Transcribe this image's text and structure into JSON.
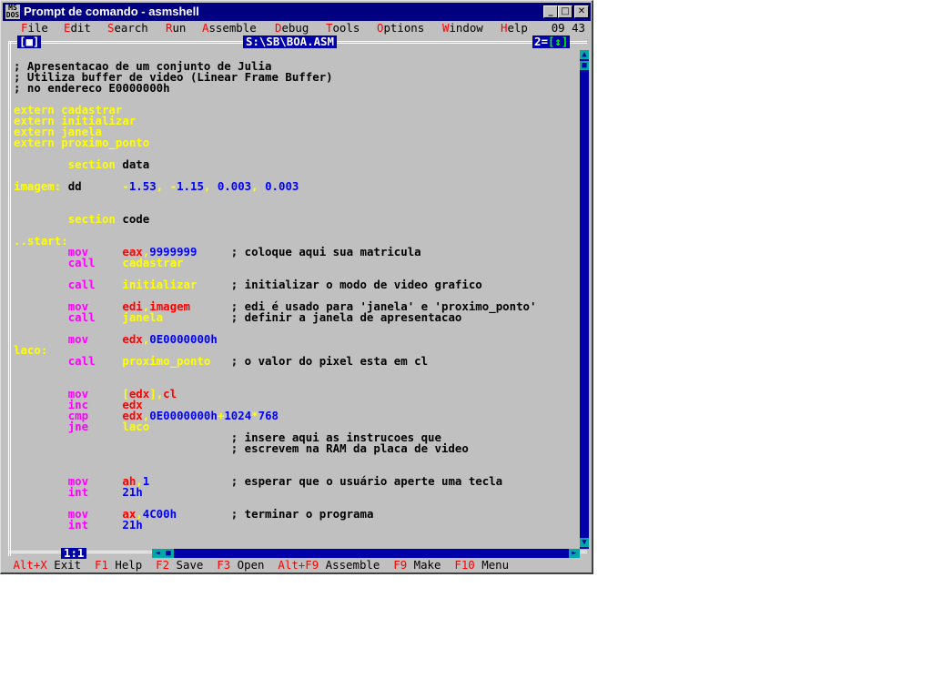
{
  "window": {
    "title": "Prompt de comando - asmshell",
    "icon_text": [
      "MS",
      "DOS"
    ],
    "controls": {
      "minimize": "_",
      "maximize": "□",
      "close": "✕"
    }
  },
  "menubar": {
    "items": [
      {
        "hot": "F",
        "rest": "ile"
      },
      {
        "hot": "E",
        "rest": "dit"
      },
      {
        "hot": "S",
        "rest": "earch"
      },
      {
        "hot": "R",
        "rest": "un"
      },
      {
        "hot": "A",
        "rest": "ssemble"
      },
      {
        "hot": "D",
        "rest": "ebug"
      },
      {
        "hot": "T",
        "rest": "ools"
      },
      {
        "hot": "O",
        "rest": "ptions"
      },
      {
        "hot": "W",
        "rest": "indow"
      },
      {
        "hot": "H",
        "rest": "elp"
      }
    ],
    "clock": "09 43"
  },
  "editor": {
    "close_box": "[■]",
    "filename": "S:\\SB\\BOA.ASM",
    "window_number": "2",
    "zoom_box": "[↕]",
    "cursor_pos": "1:1",
    "lines": [
      [
        [
          "t",
          "; Apresentacao de um conjunto de Julia"
        ]
      ],
      [
        [
          "t",
          "; Utiliza buffer de video (Linear Frame Buffer)"
        ]
      ],
      [
        [
          "t",
          "; no endereco E0000000h"
        ]
      ],
      [
        [
          "t",
          ""
        ]
      ],
      [
        [
          "k",
          "extern cadastrar"
        ]
      ],
      [
        [
          "k",
          "extern initializar"
        ]
      ],
      [
        [
          "k",
          "extern janela"
        ]
      ],
      [
        [
          "k",
          "extern proximo_ponto"
        ]
      ],
      [
        [
          "t",
          ""
        ]
      ],
      [
        [
          "t",
          "        "
        ],
        [
          "k",
          "section "
        ],
        [
          "t",
          "data"
        ]
      ],
      [
        [
          "t",
          ""
        ]
      ],
      [
        [
          "k",
          "imagem: "
        ],
        [
          "t",
          "dd      "
        ],
        [
          "k",
          "-"
        ],
        [
          "b",
          "1.53"
        ],
        [
          "k",
          ", -"
        ],
        [
          "b",
          "1.15"
        ],
        [
          "k",
          ", "
        ],
        [
          "b",
          "0.003"
        ],
        [
          "k",
          ", "
        ],
        [
          "b",
          "0.003"
        ]
      ],
      [
        [
          "t",
          ""
        ]
      ],
      [
        [
          "t",
          ""
        ]
      ],
      [
        [
          "t",
          "        "
        ],
        [
          "k",
          "section "
        ],
        [
          "t",
          "code"
        ]
      ],
      [
        [
          "t",
          ""
        ]
      ],
      [
        [
          "k",
          "..start:"
        ]
      ],
      [
        [
          "t",
          "        "
        ],
        [
          "m",
          "mov     "
        ],
        [
          "r",
          "eax"
        ],
        [
          "k",
          ","
        ],
        [
          "b",
          "9999999"
        ],
        [
          "t",
          "     ; coloque aqui sua matricula"
        ]
      ],
      [
        [
          "t",
          "        "
        ],
        [
          "m",
          "call    "
        ],
        [
          "k",
          "cadastrar"
        ]
      ],
      [
        [
          "t",
          ""
        ]
      ],
      [
        [
          "t",
          "        "
        ],
        [
          "m",
          "call    "
        ],
        [
          "k",
          "initializar"
        ],
        [
          "t",
          "     ; initializar o modo de video grafico"
        ]
      ],
      [
        [
          "t",
          ""
        ]
      ],
      [
        [
          "t",
          "        "
        ],
        [
          "m",
          "mov     "
        ],
        [
          "r",
          "edi"
        ],
        [
          "k",
          ","
        ],
        [
          "r",
          "imagem"
        ],
        [
          "t",
          "      ; edi é usado para 'janela' e 'proximo_ponto'"
        ]
      ],
      [
        [
          "t",
          "        "
        ],
        [
          "m",
          "call    "
        ],
        [
          "k",
          "janela"
        ],
        [
          "t",
          "          ; definir a janela de apresentacao"
        ]
      ],
      [
        [
          "t",
          ""
        ]
      ],
      [
        [
          "t",
          "        "
        ],
        [
          "m",
          "mov     "
        ],
        [
          "r",
          "edx"
        ],
        [
          "k",
          ","
        ],
        [
          "b",
          "0E0000000h"
        ]
      ],
      [
        [
          "k",
          "laco:"
        ]
      ],
      [
        [
          "t",
          "        "
        ],
        [
          "m",
          "call    "
        ],
        [
          "k",
          "proximo_ponto"
        ],
        [
          "t",
          "   ; o valor do pixel esta em cl"
        ]
      ],
      [
        [
          "t",
          ""
        ]
      ],
      [
        [
          "t",
          ""
        ]
      ],
      [
        [
          "t",
          "        "
        ],
        [
          "m",
          "mov     "
        ],
        [
          "k",
          "["
        ],
        [
          "r",
          "edx"
        ],
        [
          "k",
          "],"
        ],
        [
          "r",
          "cl"
        ]
      ],
      [
        [
          "t",
          "        "
        ],
        [
          "m",
          "inc     "
        ],
        [
          "r",
          "edx"
        ]
      ],
      [
        [
          "t",
          "        "
        ],
        [
          "m",
          "cmp     "
        ],
        [
          "r",
          "edx"
        ],
        [
          "k",
          ","
        ],
        [
          "b",
          "0E0000000h"
        ],
        [
          "k",
          "+"
        ],
        [
          "b",
          "1024"
        ],
        [
          "k",
          "*"
        ],
        [
          "b",
          "768"
        ]
      ],
      [
        [
          "t",
          "        "
        ],
        [
          "m",
          "jne     "
        ],
        [
          "k",
          "laco"
        ]
      ],
      [
        [
          "t",
          "                                ; insere aqui as instrucoes que"
        ]
      ],
      [
        [
          "t",
          "                                ; escrevem na RAM da placa de video"
        ]
      ],
      [
        [
          "t",
          ""
        ]
      ],
      [
        [
          "t",
          ""
        ]
      ],
      [
        [
          "t",
          "        "
        ],
        [
          "m",
          "mov     "
        ],
        [
          "r",
          "ah"
        ],
        [
          "k",
          ","
        ],
        [
          "b",
          "1"
        ],
        [
          "t",
          "            ; esperar que o usuário aperte uma tecla"
        ]
      ],
      [
        [
          "t",
          "        "
        ],
        [
          "m",
          "int     "
        ],
        [
          "b",
          "21h"
        ]
      ],
      [
        [
          "t",
          ""
        ]
      ],
      [
        [
          "t",
          "        "
        ],
        [
          "m",
          "mov     "
        ],
        [
          "r",
          "ax"
        ],
        [
          "k",
          ","
        ],
        [
          "b",
          "4C00h"
        ],
        [
          "t",
          "        ; terminar o programa"
        ]
      ],
      [
        [
          "t",
          "        "
        ],
        [
          "m",
          "int     "
        ],
        [
          "b",
          "21h"
        ]
      ]
    ]
  },
  "statusbar": {
    "items": [
      {
        "key": "Alt+X",
        "label": "Exit"
      },
      {
        "key": "F1",
        "label": "Help"
      },
      {
        "key": "F2",
        "label": "Save"
      },
      {
        "key": "F3",
        "label": "Open"
      },
      {
        "key": "Alt+F9",
        "label": "Assemble"
      },
      {
        "key": "F9",
        "label": "Make"
      },
      {
        "key": "F10",
        "label": "Menu"
      }
    ]
  },
  "colors": {
    "title_bg": "#000080",
    "editor_bg": "#c0c0c0",
    "keyword": "#ffff00",
    "instruction": "#ff00ff",
    "register": "#ff0000",
    "number": "#0000ff",
    "hotkey": "#ff0000",
    "frame": "#0000a8"
  }
}
